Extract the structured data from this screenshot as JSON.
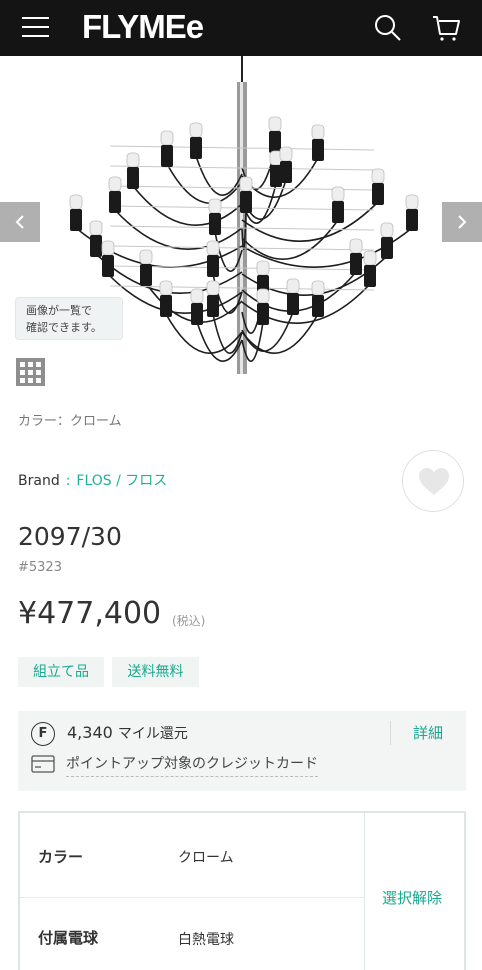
{
  "header": {
    "logo": "FLYMEe",
    "icons": [
      "menu-icon",
      "search-icon",
      "cart-icon"
    ],
    "background": "#141414"
  },
  "gallery": {
    "tooltip_line1": "画像が一覧で",
    "tooltip_line2": "確認できます。",
    "icons": [
      "chevron-left-icon",
      "chevron-right-icon",
      "grid-icon"
    ]
  },
  "product": {
    "color_line": "カラー：クローム",
    "brand_label": "Brand",
    "brand_sep": ":",
    "brand_name": "FLOS / フロス",
    "model": "2097/30",
    "sku": "#5323",
    "price": "¥477,400",
    "tax_note": "(税込)",
    "tags": [
      "組立て品",
      "送料無料"
    ]
  },
  "points": {
    "badge": "F",
    "amount": "4,340",
    "unit": "マイル還元",
    "detail_label": "詳細",
    "card_label": "ポイントアップ対象のクレジットカード"
  },
  "options": {
    "rows": [
      {
        "label": "カラー",
        "value": "クローム"
      },
      {
        "label": "付属電球",
        "value": "白熱電球"
      }
    ],
    "deselect_label": "選択解除"
  },
  "colors": {
    "accent": "#1aa88f",
    "tag_bg": "#f0f5f3",
    "panel_bg": "#f3f5f5"
  }
}
